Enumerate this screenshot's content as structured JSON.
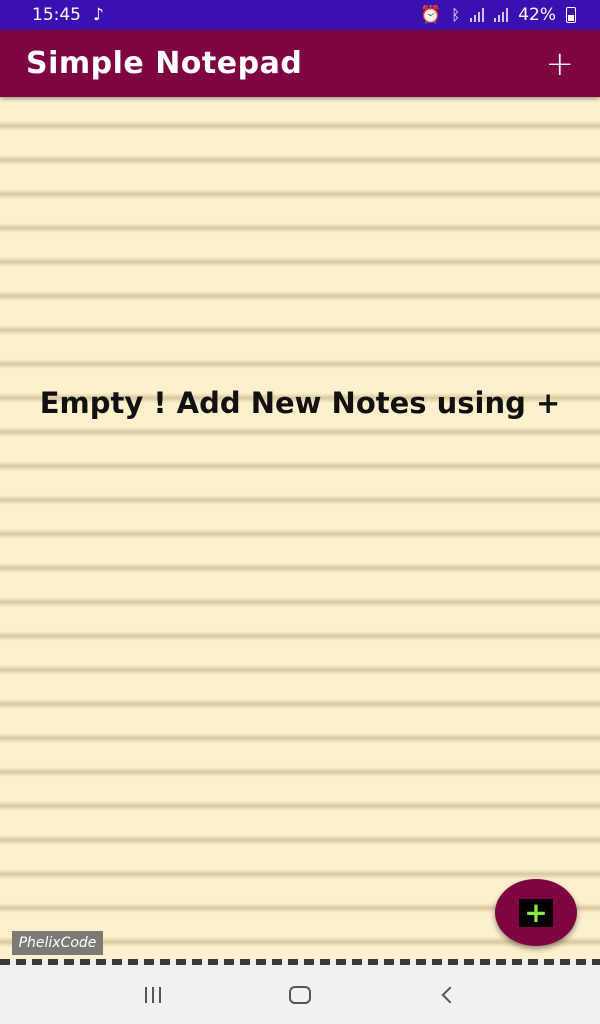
{
  "status_bar": {
    "time": "15:45",
    "battery": "42%",
    "icons": [
      "music-note-icon",
      "alarm-icon",
      "bluetooth-icon",
      "signal-icon",
      "signal-icon",
      "battery-icon"
    ]
  },
  "app_bar": {
    "title": "Simple Notepad",
    "add_label": "+"
  },
  "main": {
    "empty_message": "Empty ! Add New Notes using +"
  },
  "watermark": "PhelixCode",
  "fab": {
    "icon": "plus-icon",
    "label": "+"
  },
  "nav_bar": {
    "buttons": [
      "recents-icon",
      "home-icon",
      "back-icon"
    ]
  },
  "colors": {
    "status_bar": "#3a10b0",
    "app_bar": "#7e0442",
    "paper": "#fdf0cd",
    "fab_icon": "#8ee53f"
  }
}
